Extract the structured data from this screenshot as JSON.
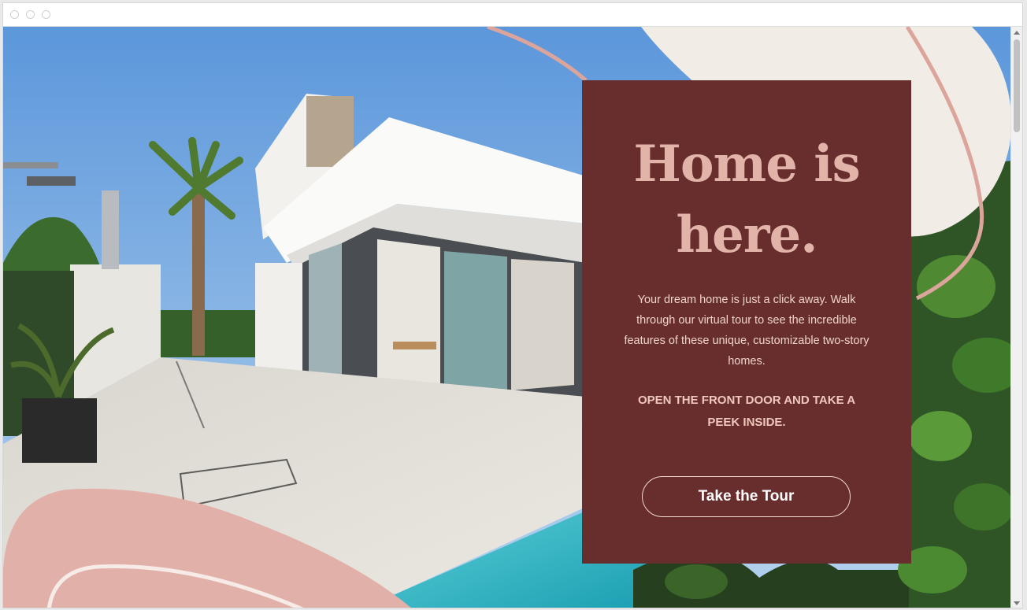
{
  "hero": {
    "headline": "Home is here.",
    "description": "Your dream home is just a click away. Walk through our virtual tour to see the incredible features of these unique, customizable two-story homes.",
    "cta_text": "OPEN THE FRONT DOOR AND TAKE A PEEK INSIDE.",
    "tour_button_label": "Take the Tour"
  },
  "colors": {
    "card_background": "#672e2d",
    "headline": "#e2b3a9",
    "accent_pink": "#e1b0a8",
    "cream_blob": "#f1ece6",
    "pool_water": "#2fb5c3",
    "sky": "#7fb3e6"
  },
  "icons": [
    "window-control-dot",
    "scroll-up-arrow",
    "scroll-down-arrow"
  ]
}
